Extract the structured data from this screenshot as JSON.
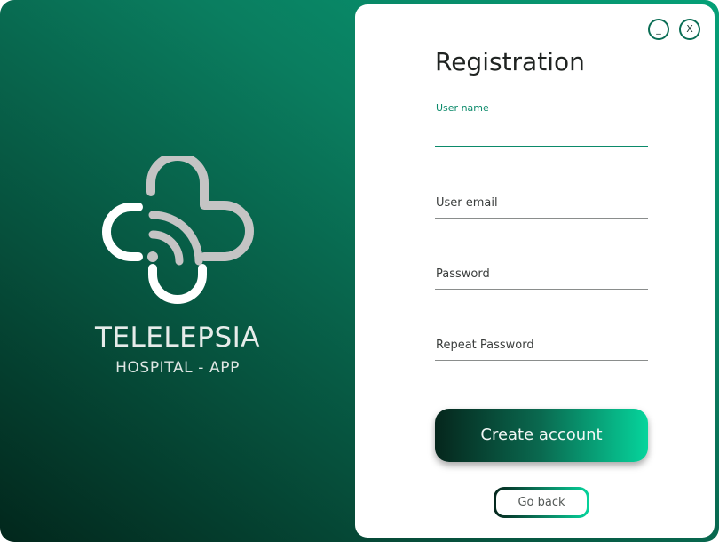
{
  "brand": {
    "title": "TELELEPSIA",
    "subtitle": "HOSPITAL - APP",
    "logo_icon": "medical-cross-wifi-icon"
  },
  "window_controls": {
    "minimize_label": "_",
    "close_label": "X"
  },
  "form": {
    "title": "Registration",
    "fields": [
      {
        "label": "User name",
        "value": "",
        "state": "focused"
      },
      {
        "label": "User email",
        "value": ""
      },
      {
        "label": "Password",
        "value": ""
      },
      {
        "label": "Repeat Password",
        "value": ""
      }
    ],
    "create_button_label": "Create account",
    "back_button_label": "Go back"
  },
  "colors": {
    "accent": "#0b8a6a",
    "gradient_dark": "#05261c",
    "gradient_light": "#06d49c",
    "logo_gray": "#c4c4c4",
    "logo_white": "#ffffff"
  }
}
